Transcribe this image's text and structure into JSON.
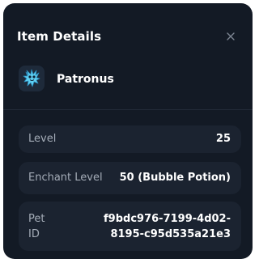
{
  "dialog": {
    "title": "Item Details",
    "close_icon": "close-icon"
  },
  "pet": {
    "icon": "patronus-pet-icon",
    "name": "Patronus"
  },
  "details": {
    "level_label": "Level",
    "level_value": "25",
    "enchant_label": "Enchant Level",
    "enchant_value": "50 (Bubble Potion)",
    "pet_id_label": "Pet ID",
    "pet_id_value": "f9bdc976-7199-4d02-8195-c95d535a21e3"
  },
  "colors": {
    "panel_bg": "#131a25",
    "card_bg": "#1b2330",
    "label_text": "#a4acb7",
    "value_text": "#ffffff",
    "pet_accent": "#5fd0f2"
  }
}
